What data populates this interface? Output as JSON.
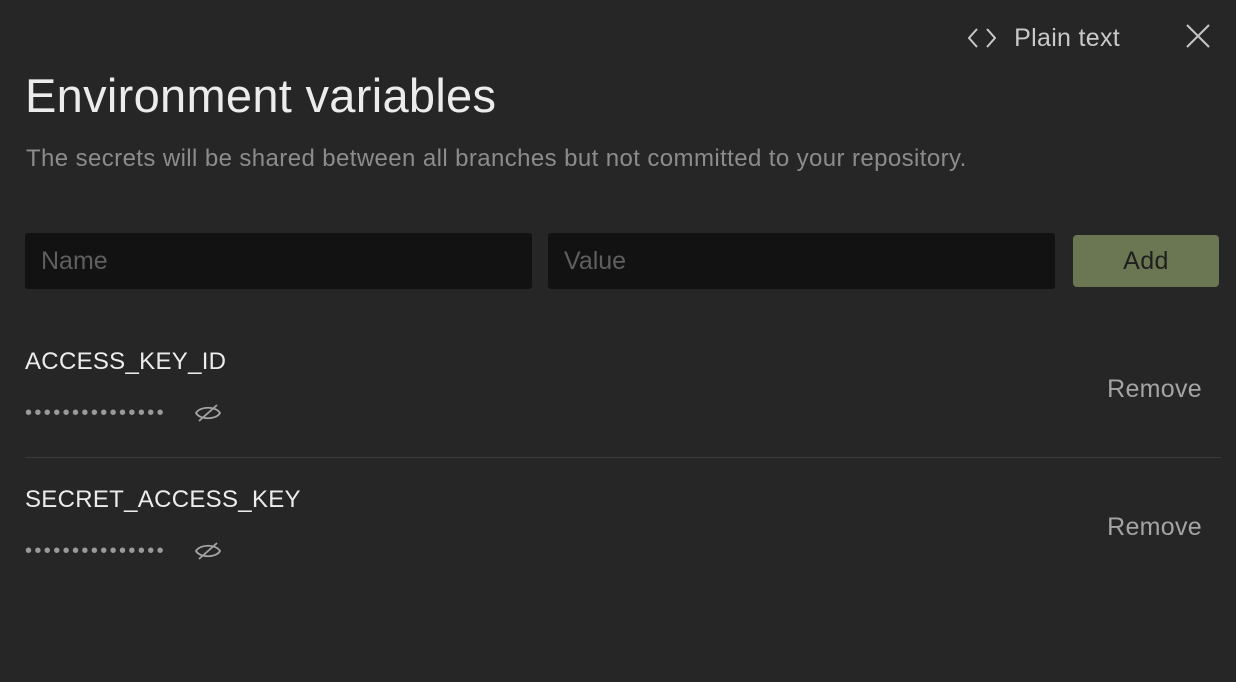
{
  "header": {
    "toggle_label": "Plain text",
    "toggle_icon": "code-brackets-icon",
    "close_icon": "close-icon"
  },
  "title": "Environment variables",
  "subtitle": "The secrets will be shared between all branches but not committed to your repository.",
  "form": {
    "name_placeholder": "Name",
    "name_value": "",
    "value_placeholder": "Value",
    "value_value": "",
    "add_label": "Add"
  },
  "variables": [
    {
      "name": "ACCESS_KEY_ID",
      "masked_value": "•••••••••••••••",
      "visibility_icon": "eye-off-icon",
      "remove_label": "Remove"
    },
    {
      "name": "SECRET_ACCESS_KEY",
      "masked_value": "•••••••••••••••",
      "visibility_icon": "eye-off-icon",
      "remove_label": "Remove"
    }
  ],
  "colors": {
    "background": "#262626",
    "input_background": "#121212",
    "accent": "#6b7752",
    "divider": "#3a3a3a"
  }
}
